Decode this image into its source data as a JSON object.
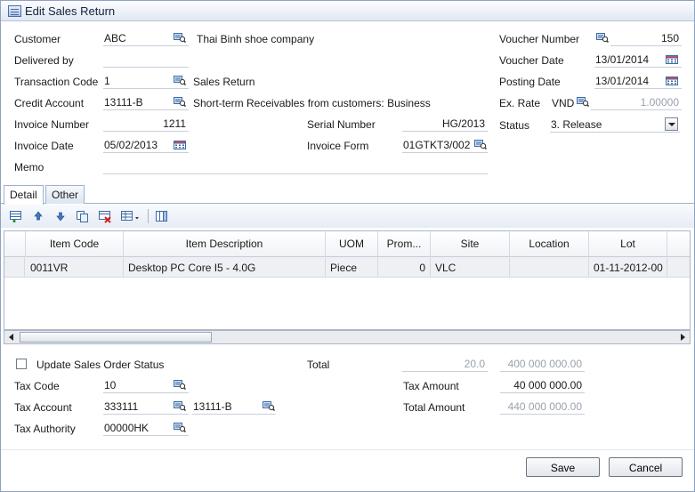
{
  "window": {
    "title": "Edit Sales Return"
  },
  "header": {
    "customer": {
      "label": "Customer",
      "code": "ABC",
      "name": "Thai Binh shoe company"
    },
    "delivered_by": {
      "label": "Delivered by",
      "value": ""
    },
    "transaction_code": {
      "label": "Transaction Code",
      "code": "1",
      "name": "Sales Return"
    },
    "credit_account": {
      "label": "Credit Account",
      "code": "13111-B",
      "name": "Short-term Receivables from customers: Business"
    },
    "invoice_number": {
      "label": "Invoice Number",
      "value": "1211"
    },
    "invoice_date": {
      "label": "Invoice Date",
      "value": "05/02/2013"
    },
    "memo": {
      "label": "Memo",
      "value": ""
    },
    "serial_number": {
      "label": "Serial Number",
      "value": "HG/2013"
    },
    "invoice_form": {
      "label": "Invoice Form",
      "value": "01GTKT3/002"
    },
    "voucher_number": {
      "label": "Voucher Number",
      "value": "150"
    },
    "voucher_date": {
      "label": "Voucher Date",
      "value": "13/01/2014"
    },
    "posting_date": {
      "label": "Posting Date",
      "value": "13/01/2014"
    },
    "ex_rate": {
      "label": "Ex. Rate",
      "currency": "VND",
      "value": "1.00000"
    },
    "status": {
      "label": "Status",
      "value": "3. Release"
    }
  },
  "tabs": [
    {
      "label": "Detail",
      "active": true
    },
    {
      "label": "Other",
      "active": false
    }
  ],
  "toolbar": {
    "icons": [
      "insert-row-icon",
      "move-up-icon",
      "move-down-icon",
      "copy-row-icon",
      "delete-row-icon",
      "export-dropdown-icon",
      "column-chooser-icon"
    ]
  },
  "grid": {
    "columns": [
      "Item Code",
      "Item Description",
      "UOM",
      "Prom...",
      "Site",
      "Location",
      "Lot"
    ],
    "rows": [
      {
        "item_code": "0011VR",
        "item_description": "Desktop PC  Core I5 - 4.0G",
        "uom": "Piece",
        "prom": "0",
        "site": "VLC",
        "location": "",
        "lot": "01-11-2012-00"
      }
    ]
  },
  "footer": {
    "update_so_status": {
      "label": "Update Sales Order Status",
      "checked": false
    },
    "tax_code": {
      "label": "Tax Code",
      "value": "10"
    },
    "tax_account": {
      "label": "Tax Account",
      "value": "333111",
      "value2": "13111-B"
    },
    "tax_authority": {
      "label": "Tax Authority",
      "value": "00000HK"
    },
    "total": {
      "label": "Total",
      "qty": "20.0",
      "amount": "400 000 000.00"
    },
    "tax_amount": {
      "label": "Tax Amount",
      "value": "40 000 000.00"
    },
    "total_amount": {
      "label": "Total Amount",
      "value": "440 000 000.00"
    },
    "save_label": "Save",
    "cancel_label": "Cancel"
  }
}
